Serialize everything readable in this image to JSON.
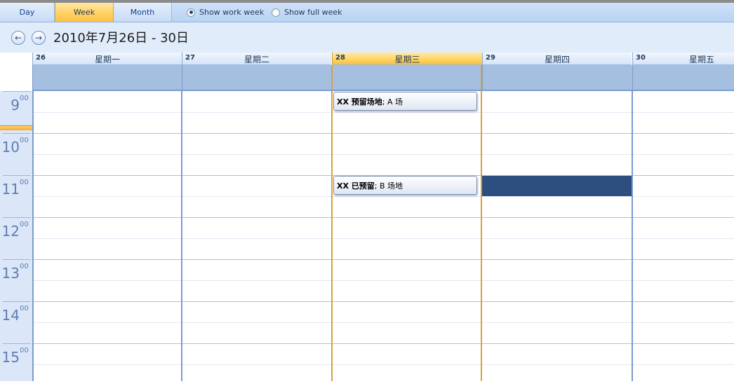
{
  "view_tabs": [
    {
      "label": "Day"
    },
    {
      "label": "Week"
    },
    {
      "label": "Month"
    }
  ],
  "options": {
    "work_week_label": "Show work week",
    "full_week_label": "Show full week"
  },
  "nav": {
    "prev_icon": "←",
    "next_icon": "→",
    "date_range": "2010年7月26日 - 30日"
  },
  "days": [
    {
      "num": "26",
      "name": "星期一"
    },
    {
      "num": "27",
      "name": "星期二"
    },
    {
      "num": "28",
      "name": "星期三"
    },
    {
      "num": "29",
      "name": "星期四"
    },
    {
      "num": "30",
      "name": "星期五"
    }
  ],
  "hours": [
    {
      "h": "9",
      "m": "00"
    },
    {
      "h": "10",
      "m": "00"
    },
    {
      "h": "11",
      "m": "00"
    },
    {
      "h": "12",
      "m": "00"
    },
    {
      "h": "13",
      "m": "00"
    },
    {
      "h": "14",
      "m": "00"
    },
    {
      "h": "15",
      "m": "00"
    }
  ],
  "appointments": [
    {
      "title": "XX  预留场地",
      "location": "; A 场"
    },
    {
      "title": "XX 已预留",
      "location": "; B 场地"
    }
  ],
  "colors": {
    "accent": "#ffc142",
    "busy_block": "#2c4f80",
    "grid_line": "#7b9bd1"
  }
}
